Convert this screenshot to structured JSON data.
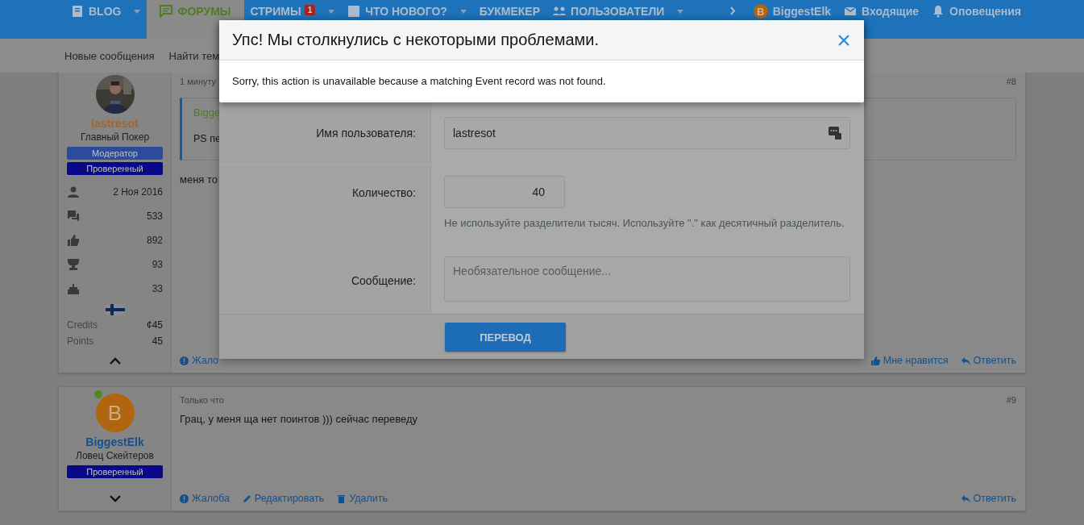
{
  "nav": {
    "items": [
      {
        "label": "BLOG",
        "selected": false,
        "dropdown": true
      },
      {
        "label": "ФОРУМЫ",
        "selected": true,
        "dropdown": false
      },
      {
        "label": "СТРИМЫ",
        "badge": "1",
        "selected": false,
        "dropdown": true
      },
      {
        "label": "ЧТО НОВОГО?",
        "selected": false,
        "dropdown": true
      },
      {
        "label": "БУКМЕКЕР",
        "selected": false,
        "dropdown": false
      },
      {
        "label": "ПОЛЬЗОВАТЕЛИ",
        "selected": false,
        "dropdown": true
      }
    ],
    "account": {
      "letter": "B",
      "name": "BiggestElk"
    },
    "links": [
      "Входящие",
      "Оповещения"
    ]
  },
  "subnav": [
    "Новые сообщения",
    "Найти тем"
  ],
  "posts": [
    {
      "user": {
        "name": "lastresot",
        "color": "#a8652a",
        "avatar": {
          "kind": "picture"
        },
        "online": false,
        "title": "Главный Покер",
        "banners": [
          {
            "label": "Модератор",
            "color": "#2b4b9b"
          },
          {
            "label": "Проверенный",
            "color": "#08088a"
          }
        ],
        "stats": [
          "2 Ноя 2016",
          "533",
          "892",
          "93",
          "33"
        ],
        "flag": true,
        "extras": [
          {
            "label": "Credits",
            "value": "¢45"
          },
          {
            "label": "Points",
            "value": "45"
          }
        ],
        "expanded": true
      },
      "time": "1 минуту",
      "number": "#8",
      "quote": {
        "author": "Bigge",
        "text": "PS пе"
      },
      "body": "меня то",
      "actions_left": [
        {
          "kind": "report",
          "label": "Жало"
        }
      ],
      "actions_right": [
        {
          "kind": "like",
          "label": "Мне нравится"
        },
        {
          "kind": "reply",
          "label": "Ответить"
        }
      ]
    },
    {
      "user": {
        "name": "BiggestElk",
        "color": "#14508c",
        "avatar": {
          "kind": "letter",
          "letter": "B"
        },
        "online": true,
        "title": "Ловец Скейтеров",
        "banners": [
          {
            "label": "Проверенный",
            "color": "#08088a"
          }
        ],
        "expanded": false
      },
      "time": "Только что",
      "number": "#9",
      "body": "Грац, у меня ща нет поинтов ))) сейчас переведу",
      "actions_left": [
        {
          "kind": "report",
          "label": "Жалоба"
        },
        {
          "kind": "edit",
          "label": "Редактировать"
        },
        {
          "kind": "delete",
          "label": "Удалить"
        }
      ],
      "actions_right": [
        {
          "kind": "reply",
          "label": "Ответить"
        }
      ]
    }
  ],
  "transfer_dialog": {
    "fields": [
      {
        "kind": "text",
        "label": "Имя пользователя:",
        "value": "lastresot"
      },
      {
        "kind": "number",
        "label": "Количество:",
        "value": "40",
        "hint": "Не используйте разделители тысяч. Используйте \".\" как десятичный разделитель."
      },
      {
        "kind": "textarea",
        "label": "Сообщение:",
        "placeholder": "Необязательное сообщение..."
      }
    ],
    "button": "ПЕРЕВОД"
  },
  "error_dialog": {
    "title": "Упс! Мы столкнулись с некоторыми проблемами.",
    "message": "Sorry, this action is unavailable because a matching Event record was not found."
  }
}
